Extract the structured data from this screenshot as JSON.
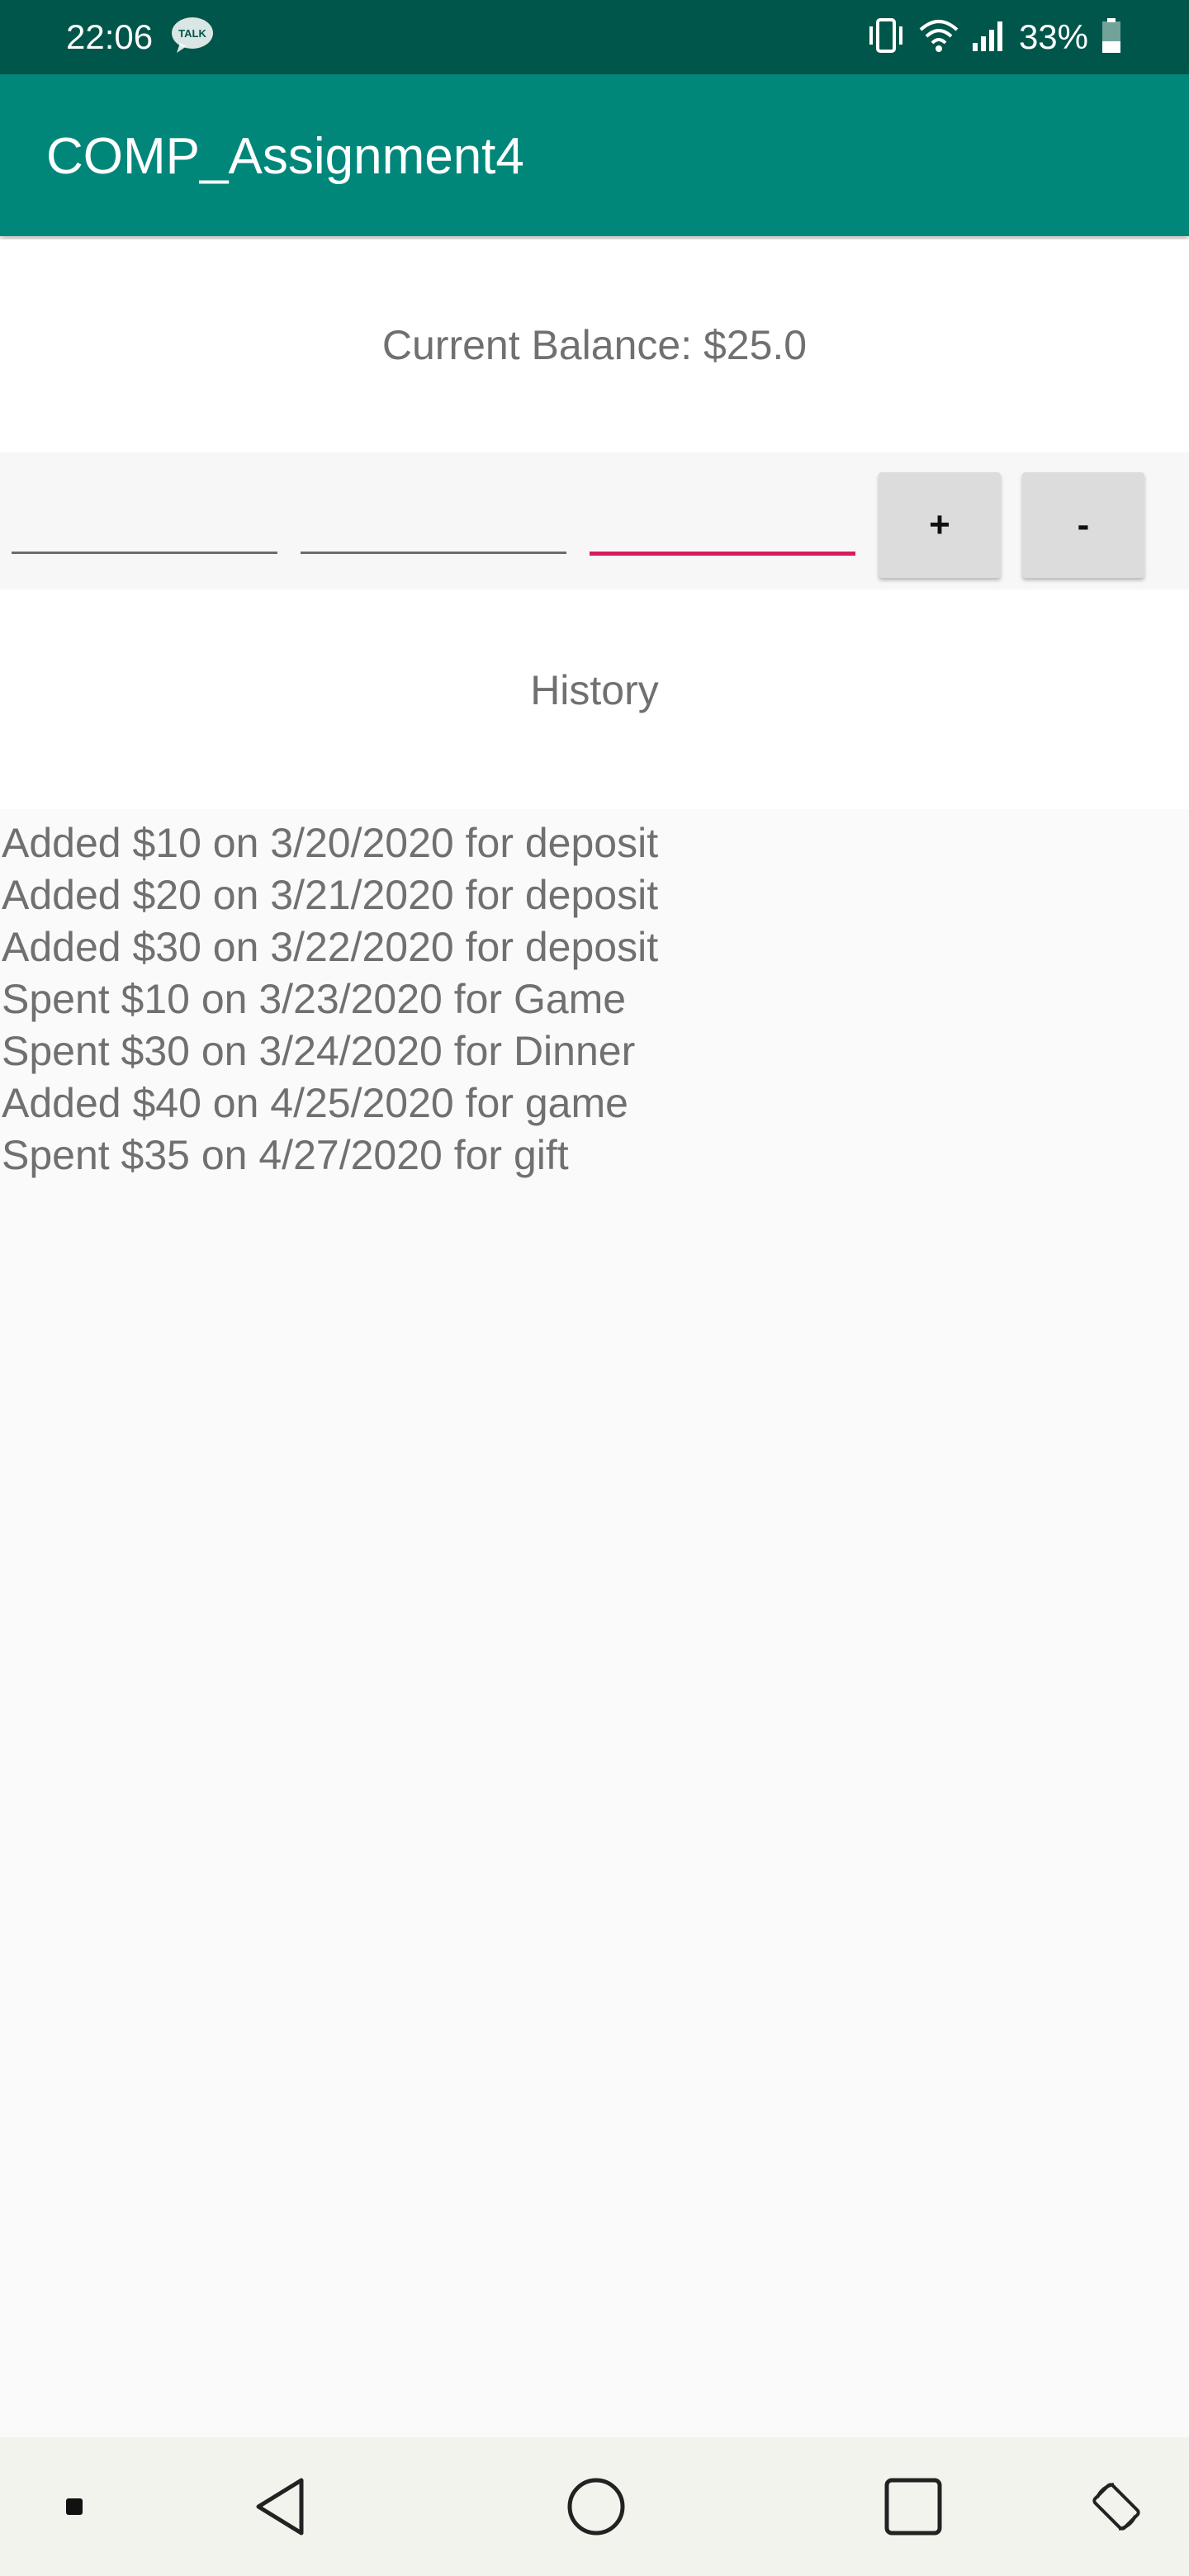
{
  "status_bar": {
    "time": "22:06",
    "notification_icon": "kakaotalk-icon",
    "notification_icon_label": "TALK",
    "battery_percent": "33%",
    "icons": [
      "vibrate-icon",
      "wifi-icon",
      "signal-icon",
      "battery-icon"
    ],
    "background_color": "#00564a"
  },
  "app_bar": {
    "title": "COMP_Assignment4",
    "background_color": "#00877a"
  },
  "balance": {
    "text": "Current Balance: $25.0"
  },
  "inputs": {
    "fields": [
      {
        "value": "",
        "placeholder": ""
      },
      {
        "value": "",
        "placeholder": ""
      },
      {
        "value": "",
        "placeholder": "",
        "focused": true
      }
    ],
    "plus_label": "+",
    "minus_label": "-",
    "focus_color": "#d81b60"
  },
  "history": {
    "title": "History",
    "items": [
      "Added $10 on 3/20/2020 for deposit",
      "Added $20 on 3/21/2020 for deposit",
      "Added $30 on 3/22/2020 for deposit",
      "Spent $10 on 3/23/2020 for Game",
      "Spent $30 on 3/24/2020 for Dinner",
      "Added $40 on 4/25/2020 for game",
      "Spent $35 on 4/27/2020 for gift"
    ]
  },
  "nav_bar": {
    "icons": [
      "notification-dot-icon",
      "back-icon",
      "home-icon",
      "recents-icon",
      "rotate-icon"
    ]
  }
}
